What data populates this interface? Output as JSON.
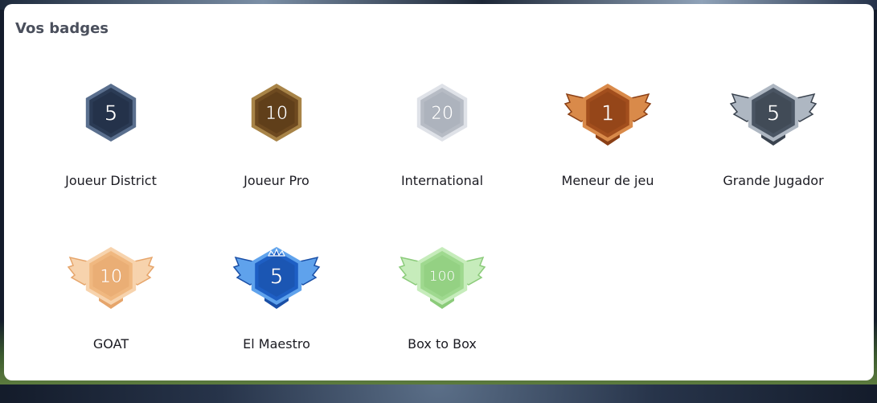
{
  "header": {
    "title": "Vos badges"
  },
  "badges": [
    {
      "label": "Joueur District",
      "number": "5",
      "icon": "hexagon-badge-icon",
      "wings": false,
      "crown": false,
      "fill": "#2b3b55",
      "rim": "#5a6f8e",
      "inner": "#1f2c42"
    },
    {
      "label": "Joueur Pro",
      "number": "10",
      "icon": "hexagon-badge-icon",
      "wings": false,
      "crown": false,
      "fill": "#6e4a20",
      "rim": "#a88448",
      "inner": "#563716"
    },
    {
      "label": "International",
      "number": "20",
      "icon": "hexagon-badge-icon",
      "wings": false,
      "crown": false,
      "fill": "#b7bcc5",
      "rim": "#dfe2e8",
      "inner": "#a6acb6"
    },
    {
      "label": "Meneur de jeu",
      "number": "1",
      "icon": "winged-badge-icon",
      "wings": true,
      "crown": false,
      "fill": "#a24e1d",
      "rim": "#d98a4a",
      "inner": "#8a3f15"
    },
    {
      "label": "Grande Jugador",
      "number": "5",
      "icon": "winged-badge-icon",
      "wings": true,
      "crown": false,
      "fill": "#4a5563",
      "rim": "#aeb7c2",
      "inner": "#3a434f"
    },
    {
      "label": "GOAT",
      "number": "10",
      "icon": "winged-badge-icon",
      "wings": true,
      "crown": false,
      "fill": "#f0b880",
      "rim": "#f7d3ad",
      "inner": "#e6a56b"
    },
    {
      "label": "El Maestro",
      "number": "5",
      "icon": "winged-crown-badge-icon",
      "wings": true,
      "crown": true,
      "fill": "#1e5fc4",
      "rim": "#5fa2ec",
      "inner": "#1a4fa6"
    },
    {
      "label": "Box to Box",
      "number": "100",
      "icon": "winged-badge-icon",
      "wings": true,
      "crown": false,
      "fill": "#9fd98f",
      "rim": "#c6ecbb",
      "inner": "#8bcb7a"
    }
  ]
}
